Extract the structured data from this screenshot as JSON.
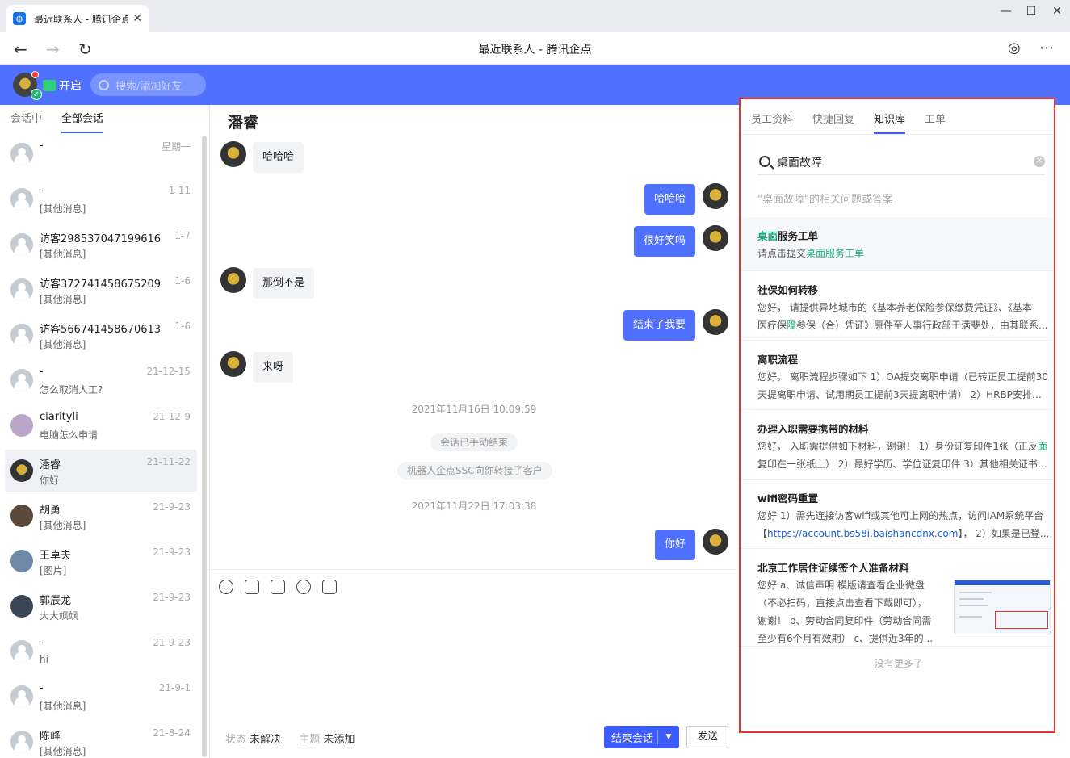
{
  "browser": {
    "tab_title": "最近联系人 - 腾讯企点",
    "page_title": "最近联系人 - 腾讯企点"
  },
  "header": {
    "status_label": "开启",
    "search_placeholder": "搜索/添加好友"
  },
  "left": {
    "tabs": [
      "会话中",
      "全部会话"
    ],
    "conversations": [
      {
        "name": "-",
        "time": "星期一",
        "preview": ""
      },
      {
        "name": "-",
        "time": "1-11",
        "preview": "[其他消息]"
      },
      {
        "name": "访客298537047199616",
        "time": "1-7",
        "preview": "[其他消息]"
      },
      {
        "name": "访客372741458675209",
        "time": "1-6",
        "preview": "[其他消息]"
      },
      {
        "name": "访客566741458670613",
        "time": "1-6",
        "preview": "[其他消息]"
      },
      {
        "name": "-",
        "time": "21-12-15",
        "preview": "怎么取消人工?"
      },
      {
        "name": "clarityli",
        "time": "21-12-9",
        "preview": "电脑怎么申请"
      },
      {
        "name": "潘睿",
        "time": "21-11-22",
        "preview": "你好"
      },
      {
        "name": "胡勇",
        "time": "21-9-23",
        "preview": "[其他消息]"
      },
      {
        "name": "王卓夫",
        "time": "21-9-23",
        "preview": "[图片]"
      },
      {
        "name": "郭辰龙",
        "time": "21-9-23",
        "preview": "大大飒飒"
      },
      {
        "name": "-",
        "time": "21-9-23",
        "preview": "hi"
      },
      {
        "name": "-",
        "time": "21-9-1",
        "preview": "[其他消息]"
      },
      {
        "name": "陈峰",
        "time": "21-8-24",
        "preview": "[其他消息]"
      }
    ]
  },
  "chat": {
    "contact_name": "潘睿",
    "messages": [
      {
        "side": "in",
        "text": "哈哈哈"
      },
      {
        "side": "out",
        "text": "哈哈哈"
      },
      {
        "side": "out",
        "text": "很好笑吗"
      },
      {
        "side": "in",
        "text": "那倒不是"
      },
      {
        "side": "out",
        "text": "结束了我要"
      },
      {
        "side": "in",
        "text": "来呀"
      },
      {
        "side": "out",
        "text": "你好"
      }
    ],
    "system": {
      "time1": "2021年11月16日 10:09:59",
      "ended": "会话已手动结束",
      "transfer": "机器人企点SSC向你转接了客户",
      "time2": "2021年11月22日 17:03:38"
    },
    "status_label": "状态",
    "status_value": "未解决",
    "topic_label": "主题",
    "topic_value": "未添加",
    "end_button": "结束会话",
    "send_button": "发送"
  },
  "right": {
    "tabs": [
      "员工资料",
      "快捷回复",
      "知识库",
      "工单"
    ],
    "search_value": "桌面故障",
    "hint": "\"桌面故障\"的相关问题或答案",
    "items": [
      {
        "title_hl": "桌面",
        "title_rest": "服务工单",
        "d1_a": "请点击提交",
        "d1_hl": "桌面服务工单"
      },
      {
        "title": "社保如何转移",
        "d1": "您好， 请提供异地城市的《基本养老保险参保缴费凭证》、《基本",
        "d2_a": "医疗保",
        "d2_hl": "障",
        "d2_b": "参保（合）凭证》原件至人事行政部于满斐处，由其联系..."
      },
      {
        "title": "离职流程",
        "d1": "您好， 离职流程步骤如下 1）OA提交离职申请（已转正员工提前30",
        "d2": "天提离职申请、试用期员工提前3天提离职申请） 2）HRBP安排离..."
      },
      {
        "title": "办理入职需要携带的材料",
        "d1_a": "您好， 入职需提供如下材料，谢谢！ 1）身份证复印件1张（正反",
        "d1_hl": "面",
        "d2": "复印在一张纸上） 2）最好学历、学位证复印件 3）其他相关证书/..."
      },
      {
        "title": "wifi密码重置",
        "d1": "您好 1）需先连接访客wifi或其他可上网的热点，访问IAM系统平台",
        "d2_a": "【",
        "d2_link": "https://account.bs58i.baishancdnx.com",
        "d2_b": "】， 2）如果是已登..."
      },
      {
        "title": "北京工作居住证续签个人准备材料",
        "d1": "您好 a、诚信声明 模版请查看企业微盘",
        "d2": "（不必扫码，直接点击查看下载即可），",
        "d3": "谢谢！ b、劳动合同复印件（劳动合同需",
        "d4": "至少有6个月有效期） c、提供近3年的..."
      }
    ],
    "no_more": "没有更多了"
  }
}
